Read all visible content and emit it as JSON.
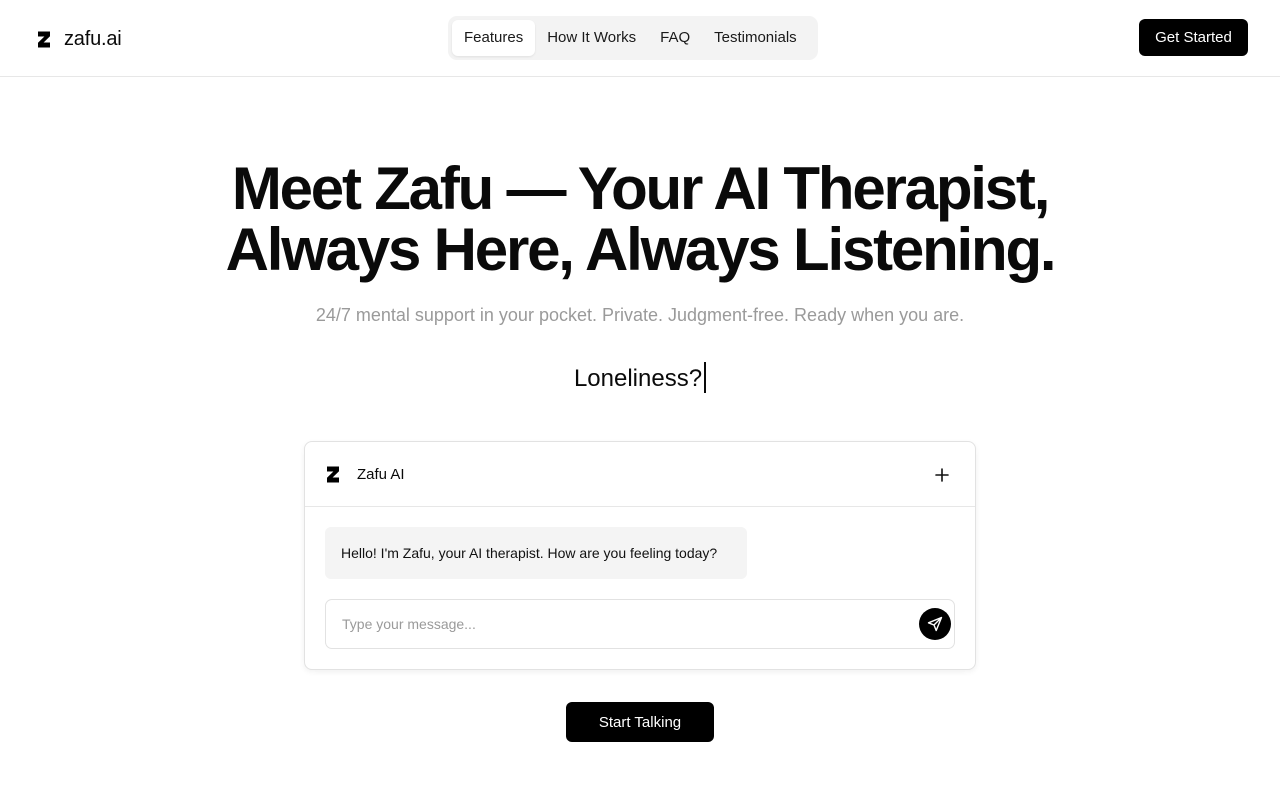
{
  "brand": {
    "name": "zafu.ai",
    "icon": "z-logo-icon"
  },
  "nav": {
    "items": [
      {
        "label": "Features",
        "active": true
      },
      {
        "label": "How It Works",
        "active": false
      },
      {
        "label": "FAQ",
        "active": false
      },
      {
        "label": "Testimonials",
        "active": false
      }
    ]
  },
  "header": {
    "cta_label": "Get Started"
  },
  "hero": {
    "title_line1": "Meet Zafu — Your AI Therapist,",
    "title_line2": "Always Here, Always Listening.",
    "subtitle": "24/7 mental support in your pocket. Private. Judgment-free. Ready when you are.",
    "typing_text": "Loneliness?"
  },
  "chat": {
    "title": "Zafu AI",
    "new_chat_icon": "plus-icon",
    "greeting": "Hello! I'm Zafu, your AI therapist. How are you feeling today?",
    "input_placeholder": "Type your message...",
    "send_icon": "send-icon"
  },
  "cta": {
    "label": "Start Talking"
  },
  "colors": {
    "primary": "#000000",
    "muted_text": "#9a9a9a",
    "surface": "#f4f4f4"
  }
}
